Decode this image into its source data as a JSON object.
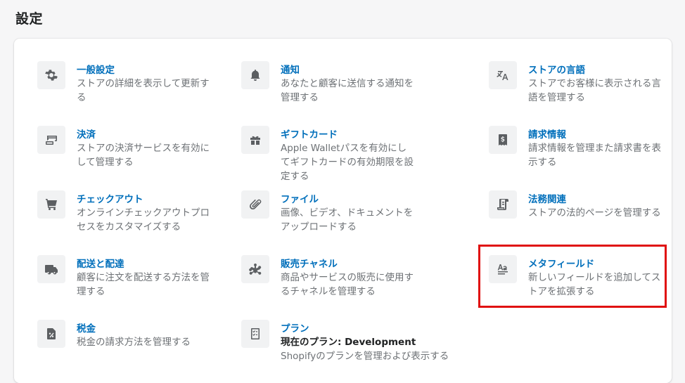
{
  "page": {
    "title": "設定"
  },
  "items": [
    {
      "icon": "gear-icon",
      "title": "一般設定",
      "desc": "ストアの詳細を表示して更新する"
    },
    {
      "icon": "bell-icon",
      "title": "通知",
      "desc": "あなたと顧客に送信する通知を管理する"
    },
    {
      "icon": "translate-icon",
      "title": "ストアの言語",
      "desc": "ストアでお客様に表示される言語を管理する"
    },
    {
      "icon": "payment-icon",
      "title": "決済",
      "desc": "ストアの決済サービスを有効にして管理する"
    },
    {
      "icon": "gift-icon",
      "title": "ギフトカード",
      "desc": "Apple Walletパスを有効にしてギフトカードの有効期限を設定する"
    },
    {
      "icon": "billing-icon",
      "title": "請求情報",
      "desc": "請求情報を管理また請求書を表示する"
    },
    {
      "icon": "cart-icon",
      "title": "チェックアウト",
      "desc": "オンラインチェックアウトプロセスをカスタマイズする"
    },
    {
      "icon": "paperclip-icon",
      "title": "ファイル",
      "desc": "画像、ビデオ、ドキュメントをアップロードする"
    },
    {
      "icon": "legal-icon",
      "title": "法務関連",
      "desc": "ストアの法的ページを管理する"
    },
    {
      "icon": "truck-icon",
      "title": "配送と配達",
      "desc": "顧客に注文を配送する方法を管理する"
    },
    {
      "icon": "channels-icon",
      "title": "販売チャネル",
      "desc": "商品やサービスの販売に使用するチャネルを管理する"
    },
    {
      "icon": "metafield-icon",
      "title": "メタフィールド",
      "desc": "新しいフィールドを追加してストアを拡張する"
    },
    {
      "icon": "tax-icon",
      "title": "税金",
      "desc": "税金の請求方法を管理する"
    },
    {
      "icon": "plan-icon",
      "title": "プラン",
      "desc_strong": "現在のプラン: Development",
      "desc": "Shopifyのプランを管理および表示する"
    }
  ]
}
